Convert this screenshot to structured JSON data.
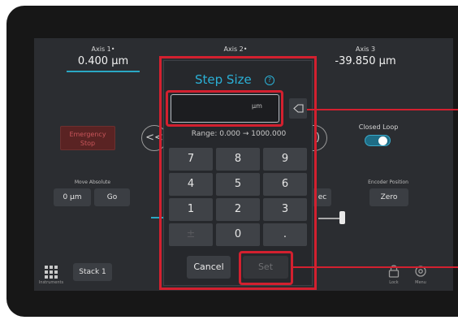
{
  "header": {
    "axis1": {
      "label": "Axis 1•",
      "value": "0.400 µm"
    },
    "axis2": {
      "label": "Axis 2•"
    },
    "axis3": {
      "label": "Axis 3",
      "value": "-39.850 µm"
    }
  },
  "left_panel": {
    "emergency_stop": {
      "line1": "Emergency",
      "line2": "Stop"
    },
    "jog_left_glyph": "<<",
    "move_absolute": {
      "label": "Move Absolute",
      "value": "0 µm",
      "go": "Go"
    }
  },
  "right_panel": {
    "closed_loop": {
      "label": "Closed Loop",
      "enabled": true
    },
    "encoder_position": {
      "label": "Encoder Position",
      "zero": "Zero"
    },
    "right_cut_button": "ec",
    "jog_right_glyph": ")"
  },
  "footer": {
    "stack_button": "Stack 1",
    "grid_label": "Instruments",
    "lock_label": "Lock",
    "menu_label": "Menu"
  },
  "dialog": {
    "title": "Step Size",
    "info_icon": "?",
    "input": {
      "value": "",
      "unit": "µm"
    },
    "range": "Range: 0.000 → 1000.000",
    "keypad": [
      {
        "label": "7",
        "enabled": true
      },
      {
        "label": "8",
        "enabled": true
      },
      {
        "label": "9",
        "enabled": true
      },
      {
        "label": "4",
        "enabled": true
      },
      {
        "label": "5",
        "enabled": true
      },
      {
        "label": "6",
        "enabled": true
      },
      {
        "label": "1",
        "enabled": true
      },
      {
        "label": "2",
        "enabled": true
      },
      {
        "label": "3",
        "enabled": true
      },
      {
        "label": "±",
        "enabled": false
      },
      {
        "label": "0",
        "enabled": true
      },
      {
        "label": ".",
        "enabled": true
      }
    ],
    "cancel": "Cancel",
    "set": "Set"
  },
  "colors": {
    "accent": "#2bb0d6",
    "highlight": "#d3202f",
    "emergency": "#5a2323",
    "panel": "#2b2d31"
  }
}
